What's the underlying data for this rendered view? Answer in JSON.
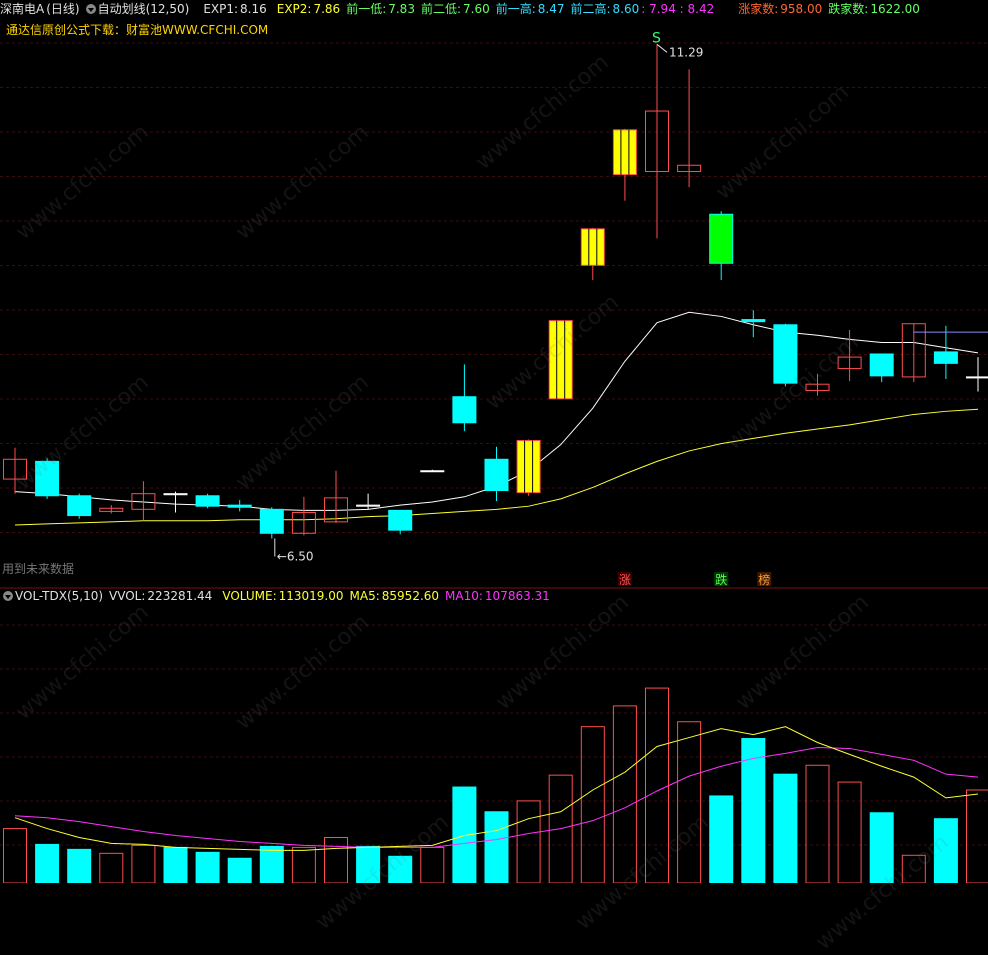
{
  "header": {
    "stock_name": "深南电A",
    "period": "(日线)",
    "indicator": "自动划线(12,50)",
    "exp1_label": "EXP1:",
    "exp1_value": "8.16",
    "exp2_label": "EXP2:",
    "exp2_value": "7.86",
    "prev_low1_label": "前一低:",
    "prev_low1_value": "7.83",
    "prev_low2_label": "前二低:",
    "prev_low2_value": "7.60",
    "prev_high1_label": "前一高:",
    "prev_high1_value": "8.47",
    "prev_high2_label": "前二高:",
    "prev_high2_value": "8.60",
    "extra_values": ": 7.94 : 8.42",
    "rise_label": "涨家数:",
    "rise_value": "958.00",
    "fall_label": "跌家数:",
    "fall_value": "1622.00",
    "source_note": "通达信原创公式下载：财富池WWW.CFCHI.COM"
  },
  "volume_header": {
    "indicator": "VOL-TDX(5,10)",
    "vvol_label": "VVOL:",
    "vvol_value": "223281.44",
    "volume_label": "VOLUME:",
    "volume_value": "113019.00",
    "ma5_label": "MA5:",
    "ma5_value": "85952.60",
    "ma10_label": "MA10:",
    "ma10_value": "107863.31"
  },
  "footnote": "用到未来数据",
  "annotations": {
    "high_label": "11.29",
    "low_label": "6.50",
    "signal_s": "S",
    "tag_up": "涨",
    "tag_down": "跌",
    "tag_list": "榜"
  },
  "watermark": "www.cfchi.com",
  "colors": {
    "bull": "#ff4d4d",
    "bear": "#00ffff",
    "limit_up_fill": "#ffff00",
    "limit_down_fill": "#00ff00",
    "ma_white": "#ffffff",
    "ma_yellow": "#ffff33",
    "ma_magenta": "#ff33ff"
  },
  "chart_data": [
    {
      "type": "candlestick",
      "title": "深南电A (日线)",
      "ylim": [
        6.2,
        11.6
      ],
      "candles": [
        {
          "o": 7.12,
          "h": 7.42,
          "l": 6.98,
          "c": 7.31,
          "kind": "up"
        },
        {
          "o": 7.29,
          "h": 7.32,
          "l": 6.93,
          "c": 6.96,
          "kind": "down"
        },
        {
          "o": 6.96,
          "h": 6.98,
          "l": 6.74,
          "c": 6.77,
          "kind": "down"
        },
        {
          "o": 6.84,
          "h": 6.87,
          "l": 6.79,
          "c": 6.81,
          "kind": "up"
        },
        {
          "o": 6.83,
          "h": 7.1,
          "l": 6.72,
          "c": 6.98,
          "kind": "up"
        },
        {
          "o": 6.98,
          "h": 7.0,
          "l": 6.8,
          "c": 6.97,
          "kind": "doji"
        },
        {
          "o": 6.96,
          "h": 6.98,
          "l": 6.84,
          "c": 6.86,
          "kind": "down"
        },
        {
          "o": 6.87,
          "h": 6.92,
          "l": 6.81,
          "c": 6.85,
          "kind": "down"
        },
        {
          "o": 6.83,
          "h": 6.85,
          "l": 6.55,
          "c": 6.6,
          "kind": "down"
        },
        {
          "o": 6.6,
          "h": 6.95,
          "l": 6.58,
          "c": 6.8,
          "kind": "up"
        },
        {
          "o": 6.71,
          "h": 7.2,
          "l": 6.7,
          "c": 6.94,
          "kind": "up"
        },
        {
          "o": 6.87,
          "h": 6.98,
          "l": 6.83,
          "c": 6.86,
          "kind": "doji"
        },
        {
          "o": 6.82,
          "h": 6.82,
          "l": 6.59,
          "c": 6.63,
          "kind": "down"
        },
        {
          "o": 7.2,
          "h": 7.21,
          "l": 7.19,
          "c": 7.2,
          "kind": "doji"
        },
        {
          "o": 7.91,
          "h": 8.22,
          "l": 7.58,
          "c": 7.66,
          "kind": "down"
        },
        {
          "o": 7.31,
          "h": 7.43,
          "l": 6.91,
          "c": 7.01,
          "kind": "down"
        },
        {
          "o": 6.99,
          "h": 7.5,
          "l": 6.96,
          "c": 7.49,
          "kind": "limit_up"
        },
        {
          "o": 7.89,
          "h": 8.37,
          "l": 8.38,
          "c": 8.64,
          "kind": "limit_up"
        },
        {
          "o": 9.17,
          "h": 9.53,
          "l": 9.03,
          "c": 9.52,
          "kind": "limit_up"
        },
        {
          "o": 10.04,
          "h": 10.48,
          "l": 9.79,
          "c": 10.47,
          "kind": "limit_up"
        },
        {
          "o": 10.07,
          "h": 11.29,
          "l": 9.43,
          "c": 10.65,
          "kind": "up"
        },
        {
          "o": 10.07,
          "h": 11.05,
          "l": 9.92,
          "c": 10.13,
          "kind": "up"
        },
        {
          "o": 9.66,
          "h": 9.69,
          "l": 9.03,
          "c": 9.19,
          "kind": "limit_down"
        },
        {
          "o": 8.63,
          "h": 8.74,
          "l": 8.48,
          "c": 8.65,
          "kind": "down"
        },
        {
          "o": 8.6,
          "h": 8.61,
          "l": 8.01,
          "c": 8.04,
          "kind": "down"
        },
        {
          "o": 7.97,
          "h": 8.13,
          "l": 7.92,
          "c": 8.03,
          "kind": "up"
        },
        {
          "o": 8.18,
          "h": 8.55,
          "l": 8.06,
          "c": 8.29,
          "kind": "up"
        },
        {
          "o": 8.32,
          "h": 8.32,
          "l": 8.05,
          "c": 8.11,
          "kind": "down"
        },
        {
          "o": 8.1,
          "h": 8.61,
          "l": 8.05,
          "c": 8.61,
          "kind": "up"
        },
        {
          "o": 8.34,
          "h": 8.59,
          "l": 8.08,
          "c": 8.23,
          "kind": "down"
        },
        {
          "o": 8.1,
          "h": 8.29,
          "l": 7.96,
          "c": 8.1,
          "kind": "doji"
        }
      ],
      "ma_white": [
        7.0,
        6.98,
        6.95,
        6.92,
        6.9,
        6.88,
        6.87,
        6.86,
        6.83,
        6.82,
        6.82,
        6.83,
        6.87,
        6.9,
        6.95,
        7.05,
        7.2,
        7.45,
        7.8,
        8.25,
        8.62,
        8.72,
        8.68,
        8.6,
        8.53,
        8.5,
        8.46,
        8.43,
        8.43,
        8.38,
        8.33
      ],
      "ma_yellow": [
        6.68,
        6.69,
        6.7,
        6.71,
        6.72,
        6.72,
        6.72,
        6.73,
        6.73,
        6.73,
        6.74,
        6.76,
        6.77,
        6.79,
        6.81,
        6.83,
        6.86,
        6.93,
        7.04,
        7.17,
        7.29,
        7.39,
        7.46,
        7.51,
        7.56,
        7.6,
        7.64,
        7.69,
        7.74,
        7.77,
        7.79
      ],
      "horizontal_line": {
        "y": 8.53,
        "from_index": 28
      }
    },
    {
      "type": "bar",
      "title": "VOL-TDX(5,10)",
      "ylim": [
        0,
        283000
      ],
      "values": [
        55000,
        39000,
        34000,
        30000,
        38000,
        36000,
        31000,
        25000,
        37000,
        36000,
        46000,
        37000,
        27000,
        36000,
        97000,
        72000,
        83000,
        109000,
        158000,
        179000,
        197000,
        163000,
        88000,
        146000,
        110000,
        119000,
        102000,
        71000,
        28000,
        65000,
        94000
      ],
      "directions": [
        "up",
        "down",
        "down",
        "up",
        "up",
        "down",
        "down",
        "down",
        "down",
        "up",
        "up",
        "down",
        "down",
        "up",
        "down",
        "down",
        "up",
        "up",
        "up",
        "up",
        "up",
        "up",
        "down",
        "down",
        "down",
        "up",
        "up",
        "down",
        "up",
        "down",
        "up"
      ],
      "ma5": [
        66000,
        55000,
        46000,
        40000,
        39000,
        36000,
        35000,
        34000,
        33000,
        33000,
        35000,
        36000,
        37000,
        38000,
        48000,
        53000,
        65000,
        72000,
        94000,
        112000,
        138000,
        147000,
        156000,
        150000,
        158000,
        142000,
        130000,
        118000,
        107000,
        86000,
        90000
      ],
      "ma5_pixel_free": true,
      "ma10": [
        68000,
        66000,
        62000,
        57000,
        52000,
        48000,
        45000,
        42000,
        40000,
        38000,
        37000,
        36000,
        36000,
        36000,
        40000,
        44000,
        50000,
        55000,
        63000,
        76000,
        93000,
        108000,
        118000,
        126000,
        131000,
        137000,
        136000,
        130000,
        124000,
        110000,
        107000
      ]
    }
  ]
}
